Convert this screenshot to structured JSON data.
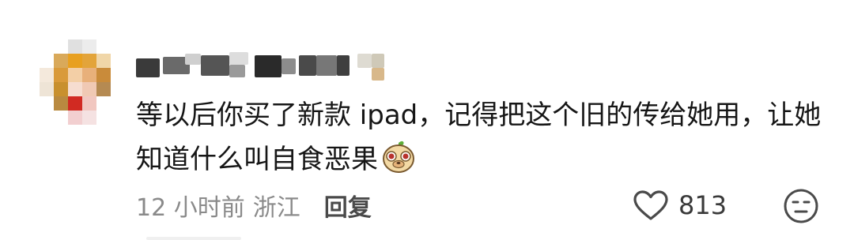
{
  "comment": {
    "text": "等以后你买了新款 ipad，记得把这个旧的传给她用，让她知道什么叫自食恶果",
    "emoji": "dog-face-emoji"
  },
  "meta": {
    "time": "12 小时前",
    "location": "浙江",
    "reply_label": "回复"
  },
  "actions": {
    "like_icon": "heart-outline-icon",
    "like_count": "813",
    "dislike_icon": "meh-face-icon"
  },
  "colors": {
    "text": "#161616",
    "meta": "#8a8a8a",
    "reply": "#4a4a4a"
  }
}
